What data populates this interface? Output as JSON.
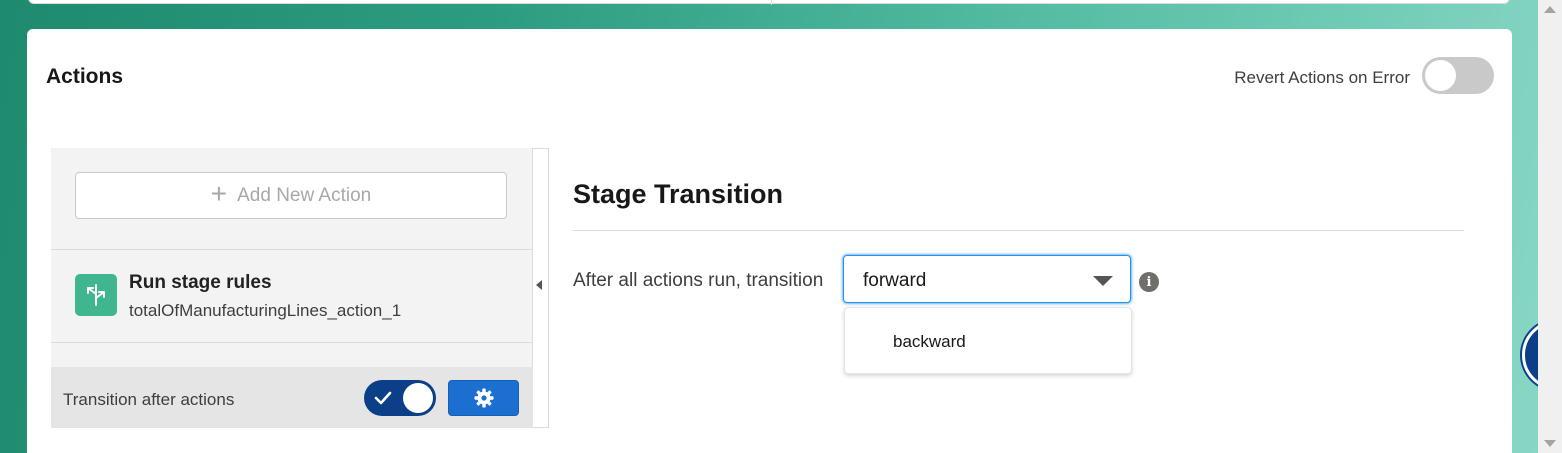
{
  "actions_card": {
    "title": "Actions",
    "revert_label": "Revert Actions on Error",
    "revert_toggle": "off"
  },
  "left_panel": {
    "add_button_label": "Add New Action",
    "action_item": {
      "title": "Run stage rules",
      "subtitle": "totalOfManufacturingLines_action_1",
      "icon": "branch-icon"
    },
    "footer": {
      "label": "Transition after actions",
      "toggle": "on"
    }
  },
  "stage_transition": {
    "title": "Stage Transition",
    "label": "After all actions run, transition",
    "selected_value": "forward",
    "options": [
      "backward"
    ]
  },
  "colors": {
    "toggle_on": "#0b3f88",
    "gear_button": "#1b6fd1",
    "action_icon_bg": "#3fb68f"
  }
}
